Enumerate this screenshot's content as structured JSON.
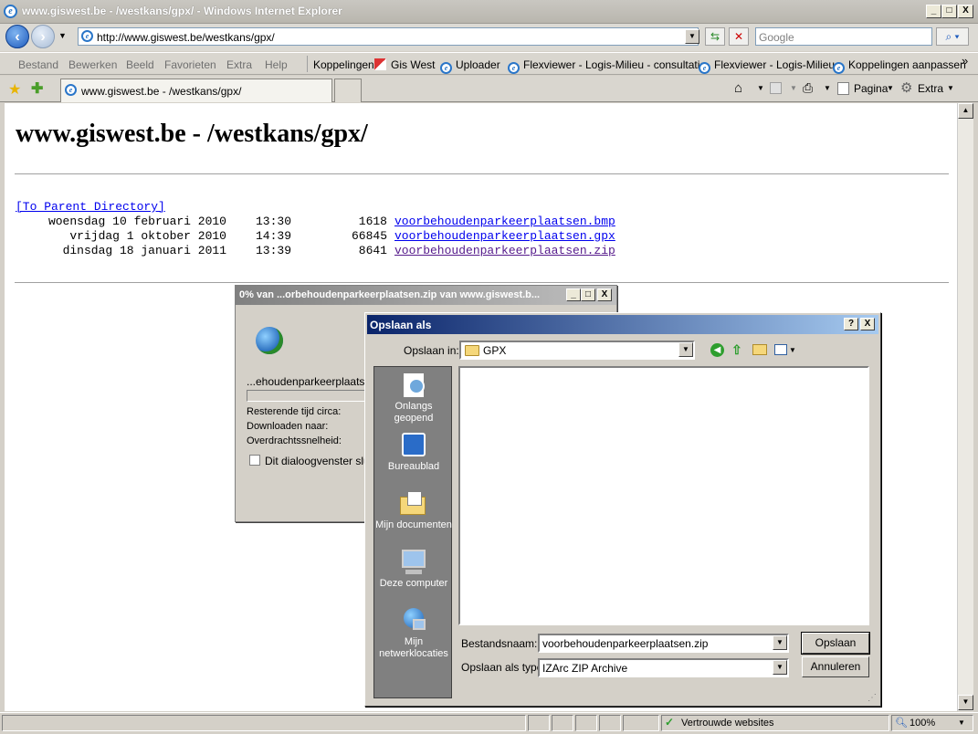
{
  "window": {
    "title": "www.giswest.be - /westkans/gpx/ - Windows Internet Explorer",
    "min": "_",
    "max": "□",
    "close": "X"
  },
  "addressbar": {
    "url": "http://www.giswest.be/westkans/gpx/",
    "search_placeholder": "Google"
  },
  "menu": [
    "Bestand",
    "Bewerken",
    "Beeld",
    "Favorieten",
    "Extra",
    "Help"
  ],
  "links": {
    "label": "Koppelingen",
    "items": [
      "Gis West",
      "Uploader",
      "Flexviewer - Logis-Milieu - consultatie",
      "Flexviewer - Logis-Milieu",
      "Koppelingen aanpassen"
    ]
  },
  "tabs": {
    "active": "www.giswest.be - /westkans/gpx/"
  },
  "commandbar": {
    "page": "Pagina",
    "tools": "Extra",
    "chevron": "»"
  },
  "page": {
    "heading": "www.giswest.be - /westkans/gpx/",
    "parent_link": "[To Parent Directory]",
    "files": [
      {
        "date": "woensdag 10 februari 2010",
        "time": "13:30",
        "size": "1618",
        "name": "voorbehoudenparkeerplaatsen.bmp"
      },
      {
        "date": "vrijdag 1 oktober 2010",
        "time": "14:39",
        "size": "66845",
        "name": "voorbehoudenparkeerplaatsen.gpx"
      },
      {
        "date": "dinsdag 18 januari 2011",
        "time": "13:39",
        "size": "8641",
        "name": "voorbehoudenparkeerplaatsen.zip"
      }
    ]
  },
  "download_dialog": {
    "title": "0% van ...orbehoudenparkeerplaatsen.zip van www.giswest.b...",
    "filename": "...ehoudenparkeerplaatsen",
    "progress": 0,
    "remaining": "Resterende tijd circa:",
    "download_to": "Downloaden naar:",
    "speed": "Overdrachtssnelheid:",
    "close_checkbox": "Dit dialoogvenster sluite"
  },
  "save_dialog": {
    "title": "Opslaan als",
    "help": "?",
    "close": "X",
    "save_in_label": "Opslaan in:",
    "save_in_value": "GPX",
    "places": [
      "Onlangs geopend",
      "Bureaublad",
      "Mijn documenten",
      "Deze computer",
      "Mijn netwerklocaties"
    ],
    "filename_label": "Bestandsnaam:",
    "filename_value": "voorbehoudenparkeerplaatsen.zip",
    "type_label": "Opslaan als type:",
    "type_value": "IZArc ZIP Archive",
    "save_button": "Opslaan",
    "cancel_button": "Annuleren"
  },
  "statusbar": {
    "zone": "Vertrouwde websites",
    "zoom": "100%"
  }
}
